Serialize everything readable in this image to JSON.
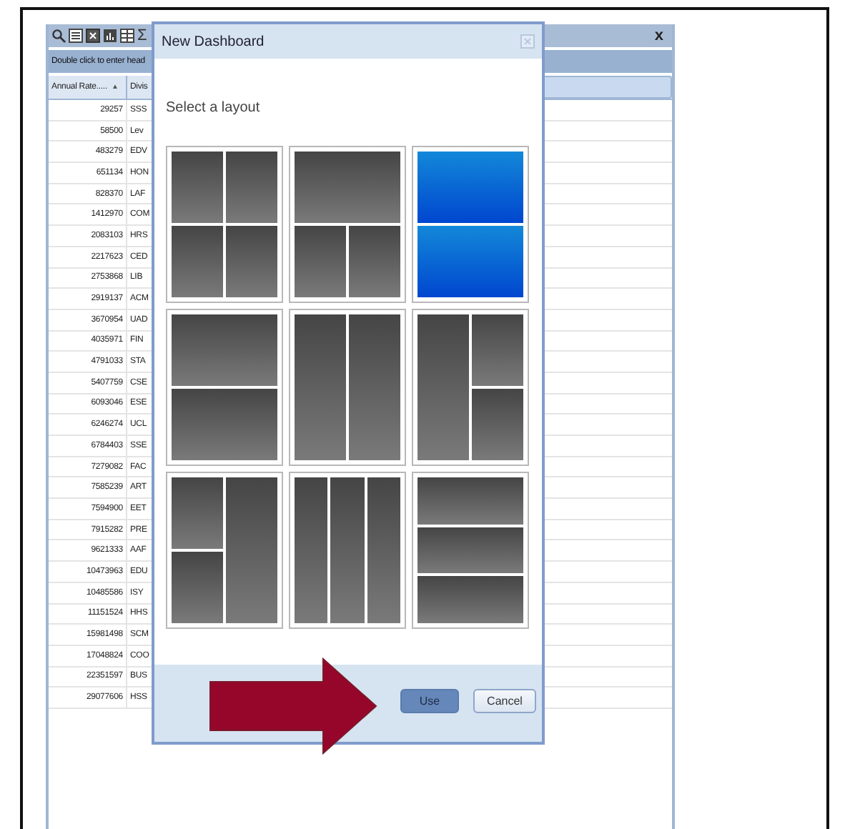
{
  "background_window": {
    "toolbar": {
      "sum_symbol": "Σ",
      "close": "x"
    },
    "header_hint": "Double click to enter head",
    "table": {
      "columns": [
        {
          "label": "Annual Rate.....",
          "sort": "▲"
        },
        {
          "label": "Divis"
        }
      ],
      "rows": [
        [
          "29257",
          "SSS"
        ],
        [
          "58500",
          "Lev"
        ],
        [
          "483279",
          "EDV"
        ],
        [
          "651134",
          "HON"
        ],
        [
          "828370",
          "LAF"
        ],
        [
          "1412970",
          "COM"
        ],
        [
          "2083103",
          "HRS"
        ],
        [
          "2217623",
          "CED"
        ],
        [
          "2753868",
          "LIB"
        ],
        [
          "2919137",
          "ACM"
        ],
        [
          "3670954",
          "UAD"
        ],
        [
          "4035971",
          "FIN"
        ],
        [
          "4791033",
          "STA"
        ],
        [
          "5407759",
          "CSE"
        ],
        [
          "6093046",
          "ESE"
        ],
        [
          "6246274",
          "UCL"
        ],
        [
          "6784403",
          "SSE"
        ],
        [
          "7279082",
          "FAC"
        ],
        [
          "7585239",
          "ART"
        ],
        [
          "7594900",
          "EET"
        ],
        [
          "7915282",
          "PRE"
        ],
        [
          "9621333",
          "AAF"
        ],
        [
          "10473963",
          "EDU"
        ],
        [
          "10485586",
          "ISY"
        ],
        [
          "11151524",
          "HHS"
        ],
        [
          "15981498",
          "SCM"
        ],
        [
          "17048824",
          "COO"
        ],
        [
          "22351597",
          "BUS"
        ],
        [
          "29077606",
          "HSS"
        ]
      ]
    }
  },
  "dialog": {
    "title": "New Dashboard",
    "prompt": "Select a layout",
    "layouts": [
      {
        "kind": "quad",
        "selected": false
      },
      {
        "kind": "top-split",
        "selected": false
      },
      {
        "kind": "rows-2",
        "selected": true
      },
      {
        "kind": "rows-2",
        "selected": false
      },
      {
        "kind": "columns-2",
        "selected": false
      },
      {
        "kind": "right-split",
        "selected": false
      },
      {
        "kind": "left-split",
        "selected": false
      },
      {
        "kind": "columns-3",
        "selected": false
      },
      {
        "kind": "rows-3",
        "selected": false
      }
    ],
    "buttons": [
      {
        "label": "Use",
        "kind": "primary"
      },
      {
        "label": "Cancel",
        "kind": "secondary"
      }
    ]
  }
}
